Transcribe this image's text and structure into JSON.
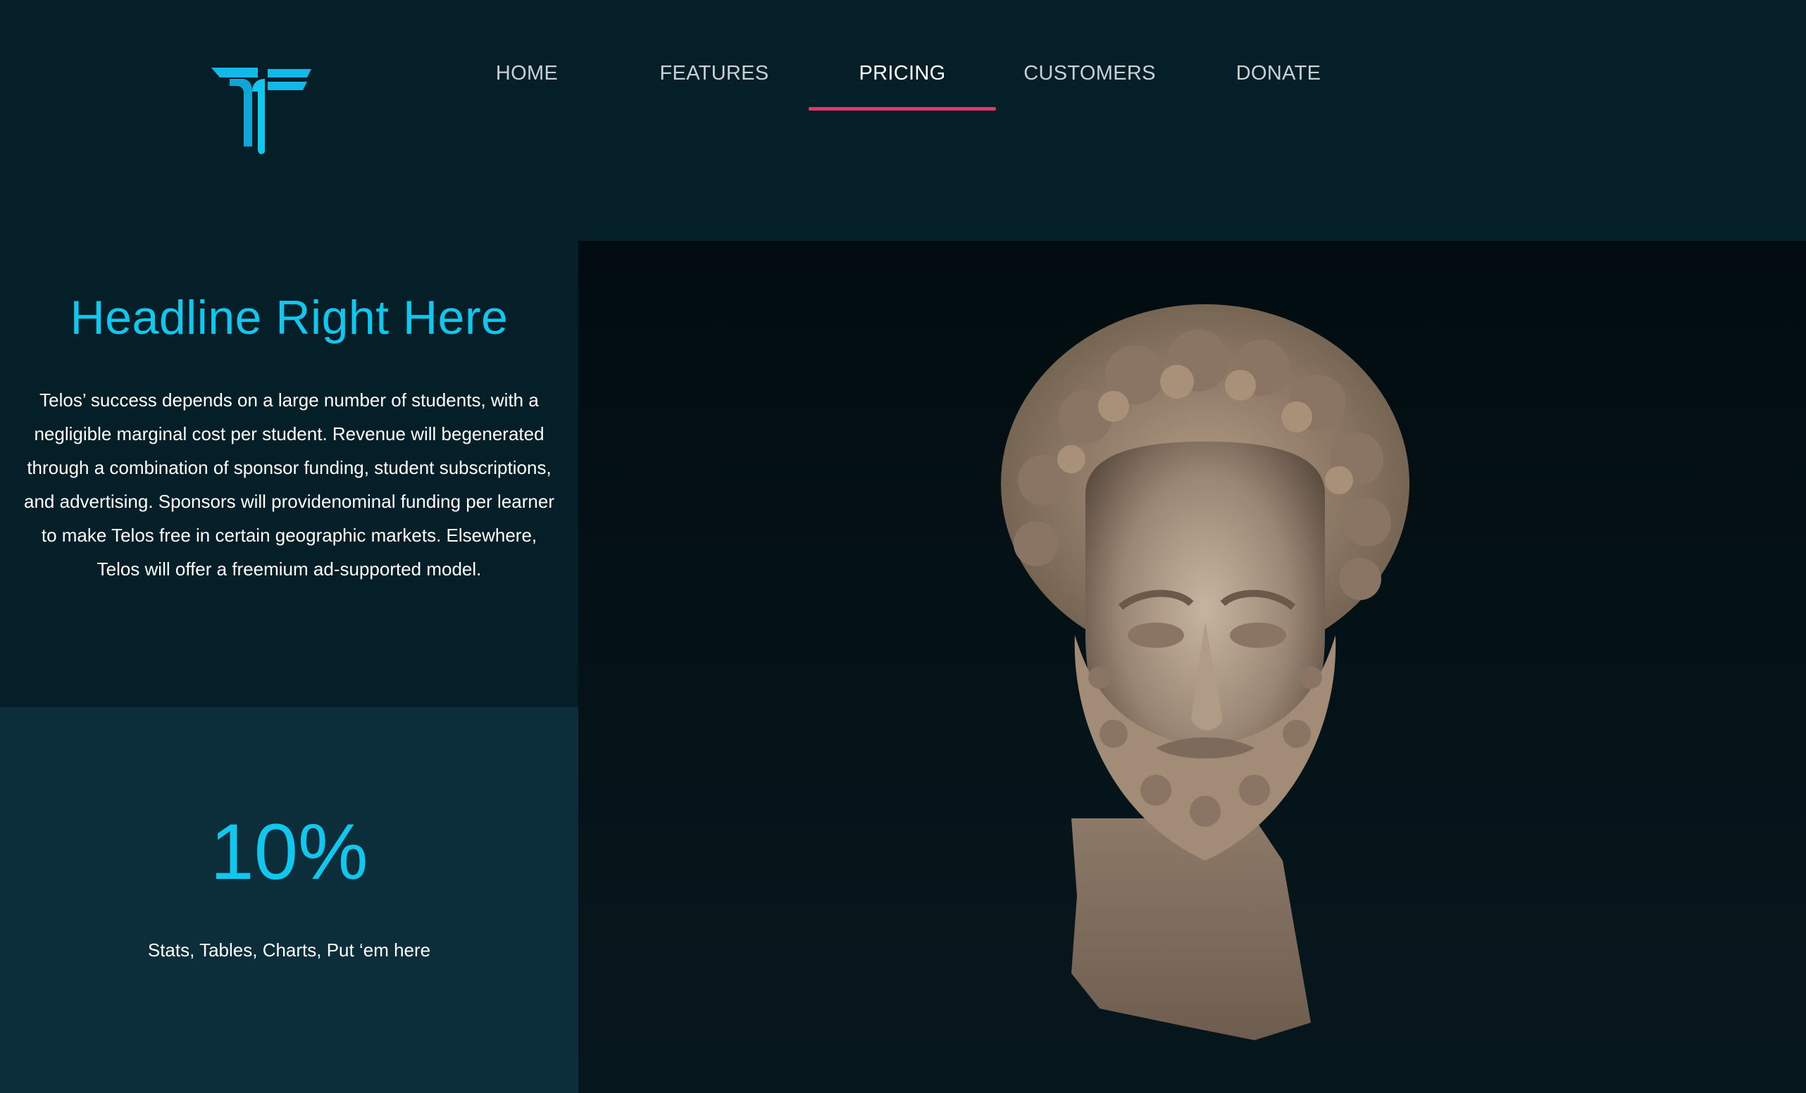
{
  "brand": {
    "logo_icon": "telos-t-logo-icon",
    "accent": "#12c7ee"
  },
  "nav": {
    "items": [
      {
        "label": "HOME"
      },
      {
        "label": "FEATURES"
      },
      {
        "label": "PRICING"
      },
      {
        "label": "CUSTOMERS"
      },
      {
        "label": "DONATE"
      }
    ],
    "active_item": "PRICING",
    "underline_color": "#e0386b"
  },
  "hero": {
    "headline": "Headline Right Here",
    "body": "Telos’ success depends on a large number of students, with a negligible marginal cost per student. Revenue will begenerated through a combination of sponsor funding, student subscriptions, and advertising. Sponsors will providenominal funding per learner to make Telos free in certain geographic markets. Elsewhere, Telos will offer a freemium ad-supported model."
  },
  "stat": {
    "value": "10%",
    "caption": "Stats, Tables, Charts, Put ‘em here"
  },
  "image": {
    "subject": "marble-bust-image"
  }
}
